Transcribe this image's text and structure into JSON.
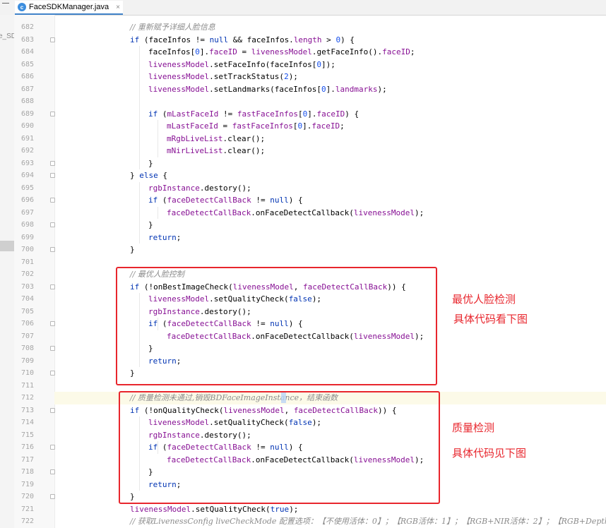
{
  "tab": {
    "label": "FaceSDKManager.java",
    "icon_letter": "c",
    "close": "×"
  },
  "left_panel_label": "e_SD",
  "lines": [
    {
      "n": "682",
      "indent": 0,
      "html": "<span class=\"c\">// 重新赋予详细人脸信息</span>"
    },
    {
      "n": "683",
      "indent": 0,
      "html": "<span class=\"k\">if</span> (faceInfos != <span class=\"k\">null</span> &amp;&amp; faceInfos.<span class=\"f\">length</span> &gt; <span class=\"n\">0</span>) {"
    },
    {
      "n": "684",
      "indent": 1,
      "html": "faceInfos[<span class=\"n\">0</span>].<span class=\"f\">faceID</span> = <span class=\"f\">livenessModel</span>.getFaceInfo().<span class=\"f\">faceID</span>;"
    },
    {
      "n": "685",
      "indent": 1,
      "html": "<span class=\"f\">livenessModel</span>.setFaceInfo(faceInfos[<span class=\"n\">0</span>]);"
    },
    {
      "n": "686",
      "indent": 1,
      "html": "<span class=\"f\">livenessModel</span>.setTrackStatus(<span class=\"n\">2</span>);"
    },
    {
      "n": "687",
      "indent": 1,
      "html": "<span class=\"f\">livenessModel</span>.setLandmarks(faceInfos[<span class=\"n\">0</span>].<span class=\"f\">landmarks</span>);"
    },
    {
      "n": "688",
      "indent": 0,
      "html": ""
    },
    {
      "n": "689",
      "indent": 1,
      "html": "<span class=\"k\">if</span> (<span class=\"f\">mLastFaceId</span> != <span class=\"f\">fastFaceInfos</span>[<span class=\"n\">0</span>].<span class=\"f\">faceID</span>) {"
    },
    {
      "n": "690",
      "indent": 2,
      "html": "<span class=\"f\">mLastFaceId</span> = <span class=\"f\">fastFaceInfos</span>[<span class=\"n\">0</span>].<span class=\"f\">faceID</span>;"
    },
    {
      "n": "691",
      "indent": 2,
      "html": "<span class=\"f\">mRgbLiveList</span>.clear();"
    },
    {
      "n": "692",
      "indent": 2,
      "html": "<span class=\"f\">mNirLiveList</span>.clear();"
    },
    {
      "n": "693",
      "indent": 1,
      "html": "}"
    },
    {
      "n": "694",
      "indent": 0,
      "html": "} <span class=\"k\">else</span> {"
    },
    {
      "n": "695",
      "indent": 1,
      "html": "<span class=\"f\">rgbInstance</span>.destory();"
    },
    {
      "n": "696",
      "indent": 1,
      "html": "<span class=\"k\">if</span> (<span class=\"f\">faceDetectCallBack</span> != <span class=\"k\">null</span>) {"
    },
    {
      "n": "697",
      "indent": 2,
      "html": "<span class=\"f\">faceDetectCallBack</span>.onFaceDetectCallback(<span class=\"f\">livenessModel</span>);"
    },
    {
      "n": "698",
      "indent": 1,
      "html": "}"
    },
    {
      "n": "699",
      "indent": 1,
      "html": "<span class=\"k\">return</span>;"
    },
    {
      "n": "700",
      "indent": 0,
      "html": "}"
    },
    {
      "n": "701",
      "indent": 0,
      "html": ""
    },
    {
      "n": "702",
      "indent": 0,
      "html": "<span class=\"c\">// 最优人脸控制</span>"
    },
    {
      "n": "703",
      "indent": 0,
      "html": "<span class=\"k\">if</span> (!onBestImageCheck(<span class=\"f\">livenessModel</span>, <span class=\"f\">faceDetectCallBack</span>)) {"
    },
    {
      "n": "704",
      "indent": 1,
      "html": "<span class=\"f\">livenessModel</span>.setQualityCheck(<span class=\"k\">false</span>);"
    },
    {
      "n": "705",
      "indent": 1,
      "html": "<span class=\"f\">rgbInstance</span>.destory();"
    },
    {
      "n": "706",
      "indent": 1,
      "html": "<span class=\"k\">if</span> (<span class=\"f\">faceDetectCallBack</span> != <span class=\"k\">null</span>) {"
    },
    {
      "n": "707",
      "indent": 2,
      "html": "<span class=\"f\">faceDetectCallBack</span>.onFaceDetectCallback(<span class=\"f\">livenessModel</span>);"
    },
    {
      "n": "708",
      "indent": 1,
      "html": "}"
    },
    {
      "n": "709",
      "indent": 1,
      "html": "<span class=\"k\">return</span>;"
    },
    {
      "n": "710",
      "indent": 0,
      "html": "}"
    },
    {
      "n": "711",
      "indent": 0,
      "html": ""
    },
    {
      "n": "712",
      "indent": 0,
      "current": true,
      "html": "<span class=\"c\">// 质量检测未通过,销毁BDFaceImageInstance，结束函数</span>"
    },
    {
      "n": "713",
      "indent": 0,
      "html": "<span class=\"k\">if</span> (!onQualityCheck(<span class=\"f\">livenessModel</span>, <span class=\"f\">faceDetectCallBack</span>)) {"
    },
    {
      "n": "714",
      "indent": 1,
      "html": "<span class=\"f\">livenessModel</span>.setQualityCheck(<span class=\"k\">false</span>);"
    },
    {
      "n": "715",
      "indent": 1,
      "html": "<span class=\"f\">rgbInstance</span>.destory();"
    },
    {
      "n": "716",
      "indent": 1,
      "html": "<span class=\"k\">if</span> (<span class=\"f\">faceDetectCallBack</span> != <span class=\"k\">null</span>) {"
    },
    {
      "n": "717",
      "indent": 2,
      "html": "<span class=\"f\">faceDetectCallBack</span>.onFaceDetectCallback(<span class=\"f\">livenessModel</span>);"
    },
    {
      "n": "718",
      "indent": 1,
      "html": "}"
    },
    {
      "n": "719",
      "indent": 1,
      "html": "<span class=\"k\">return</span>;"
    },
    {
      "n": "720",
      "indent": 0,
      "html": "}"
    },
    {
      "n": "721",
      "indent": 0,
      "html": "<span class=\"f\">livenessModel</span>.setQualityCheck(<span class=\"k\">true</span>);"
    },
    {
      "n": "722",
      "indent": 0,
      "html": "<span class=\"c\">// 获取LivenessConfig liveCheckMode 配置选项：【不使用活体：0】；【RGB活体：1】；【RGB+NIR活体：2】；【RGB+Depth活体：</span>"
    }
  ],
  "annotations": {
    "best_face_title": "最优人脸检测",
    "best_face_sub": "具体代码看下图",
    "quality_title": "质量检测",
    "quality_sub": "具体代码见下图"
  },
  "colors": {
    "annotation_red": "#e8262d",
    "keyword": "#0033b3",
    "field": "#871094",
    "number": "#1750eb",
    "comment": "#8c8c8c"
  }
}
